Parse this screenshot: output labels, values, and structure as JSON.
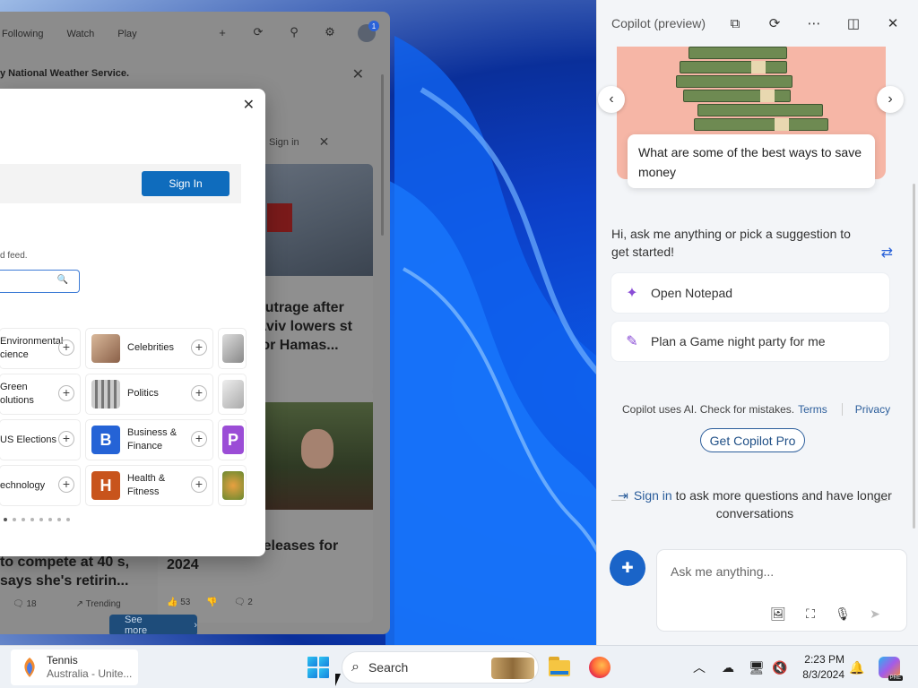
{
  "widgets": {
    "tabs": [
      "Following",
      "Watch",
      "Play"
    ],
    "alert_text": "y National Weather Service.",
    "signin_link": "Sign in",
    "card1_title": "outrage after Aviv lowers st for Hamas...",
    "card1_meta": "s",
    "card2_title": "heavy album releases for 2024",
    "card2_likes": "53",
    "card2_comments": "2",
    "left_title": "to compete at 40 s, says she's retirin...",
    "left_comments": "18",
    "left_trending": "Trending",
    "see_more": "See more",
    "notification_count": "1"
  },
  "dialog": {
    "sign_in_button": "Sign In",
    "hint": "d feed.",
    "categories": [
      {
        "label_left": "Environmental cience",
        "label_right": "Celebrities",
        "tile_right": "",
        "tile_color": ""
      },
      {
        "label_left": "Green olutions",
        "label_right": "Politics",
        "tile_right": "",
        "tile_color": ""
      },
      {
        "label_left": "US Elections",
        "label_right": "Business & Finance",
        "tile_right": "B",
        "tile_color": "#2563d6",
        "edge_tile": "P"
      },
      {
        "label_left": "echnology",
        "label_right": "Health & Fitness",
        "tile_right": "H",
        "tile_color": "#c8541c"
      }
    ]
  },
  "copilot": {
    "title": "Copilot (preview)",
    "suggestion_card": "What are some of the best ways to save money",
    "greeting": "Hi, ask me anything or pick a suggestion to get started!",
    "options": [
      "Open Notepad",
      "Plan a Game night party for me"
    ],
    "disclaimer": "Copilot uses AI. Check for mistakes.",
    "terms": "Terms",
    "privacy": "Privacy",
    "pro_button": "Get Copilot Pro",
    "signin_link": "Sign in",
    "signin_rest": "to ask more questions and have longer conversations",
    "ask_placeholder": "Ask me anything..."
  },
  "taskbar": {
    "weather_title": "Tennis",
    "weather_sub": "Australia - Unite...",
    "search_label": "Search",
    "time": "2:23 PM",
    "date": "8/3/2024",
    "copilot_badge": "PRE"
  }
}
